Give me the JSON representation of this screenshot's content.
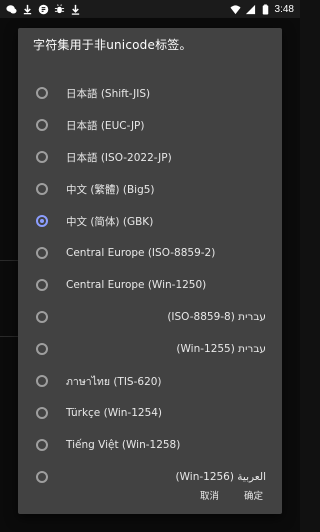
{
  "status_bar": {
    "left_icons": [
      "wechat-icon",
      "download-icon",
      "app-icon",
      "bug-icon",
      "download-arrow-icon"
    ],
    "right_icons": [
      "wifi-icon",
      "signal-icon",
      "battery-icon"
    ],
    "time": "3:48"
  },
  "dialog": {
    "title": "字符集用于非unicode标签。",
    "selected_index": 4,
    "options": [
      {
        "label": "日本語 (Shift-JIS)"
      },
      {
        "label": "日本語 (EUC-JP)"
      },
      {
        "label": "日本語 (ISO-2022-JP)"
      },
      {
        "label": "中文 (繁體) (Big5)"
      },
      {
        "label": "中文 (简体) (GBK)"
      },
      {
        "label": "Central Europe (ISO-8859-2)"
      },
      {
        "label": "Central Europe (Win-1250)"
      },
      {
        "label": "עברית (ISO-8859-8)"
      },
      {
        "label": "עברית (Win-1255)"
      },
      {
        "label": "ภาษาไทย (TIS-620)"
      },
      {
        "label": "Türkçe (Win-1254)"
      },
      {
        "label": "Tiếng Việt (Win-1258)"
      },
      {
        "label": "العربية (Win-1256)"
      }
    ],
    "cancel_label": "取消",
    "ok_label": "确定"
  },
  "colors": {
    "dialog_bg": "#424242",
    "accent": "#8c9eff",
    "radio_unchecked": "#9e9e9e"
  }
}
